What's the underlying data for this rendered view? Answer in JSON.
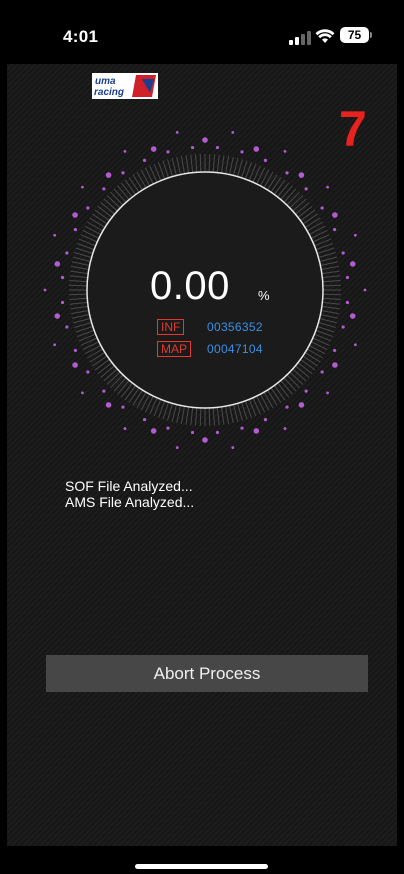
{
  "status_bar": {
    "time": "4:01",
    "battery": "75"
  },
  "app": {
    "logo": {
      "line1": "uma",
      "line2": "racing"
    },
    "step_number": "7",
    "progress": {
      "value": "0.00",
      "unit": "%"
    },
    "info": [
      {
        "tag": "INF",
        "value": "00356352"
      },
      {
        "tag": "MAP",
        "value": "00047104"
      }
    ],
    "log_lines": [
      "SOF File Analyzed...",
      "AMS File Analyzed..."
    ],
    "abort_label": "Abort Process"
  },
  "colors": {
    "accent_red": "#e8231f",
    "value_blue": "#3d8fe6",
    "dot_purple": "#b35bd1"
  }
}
